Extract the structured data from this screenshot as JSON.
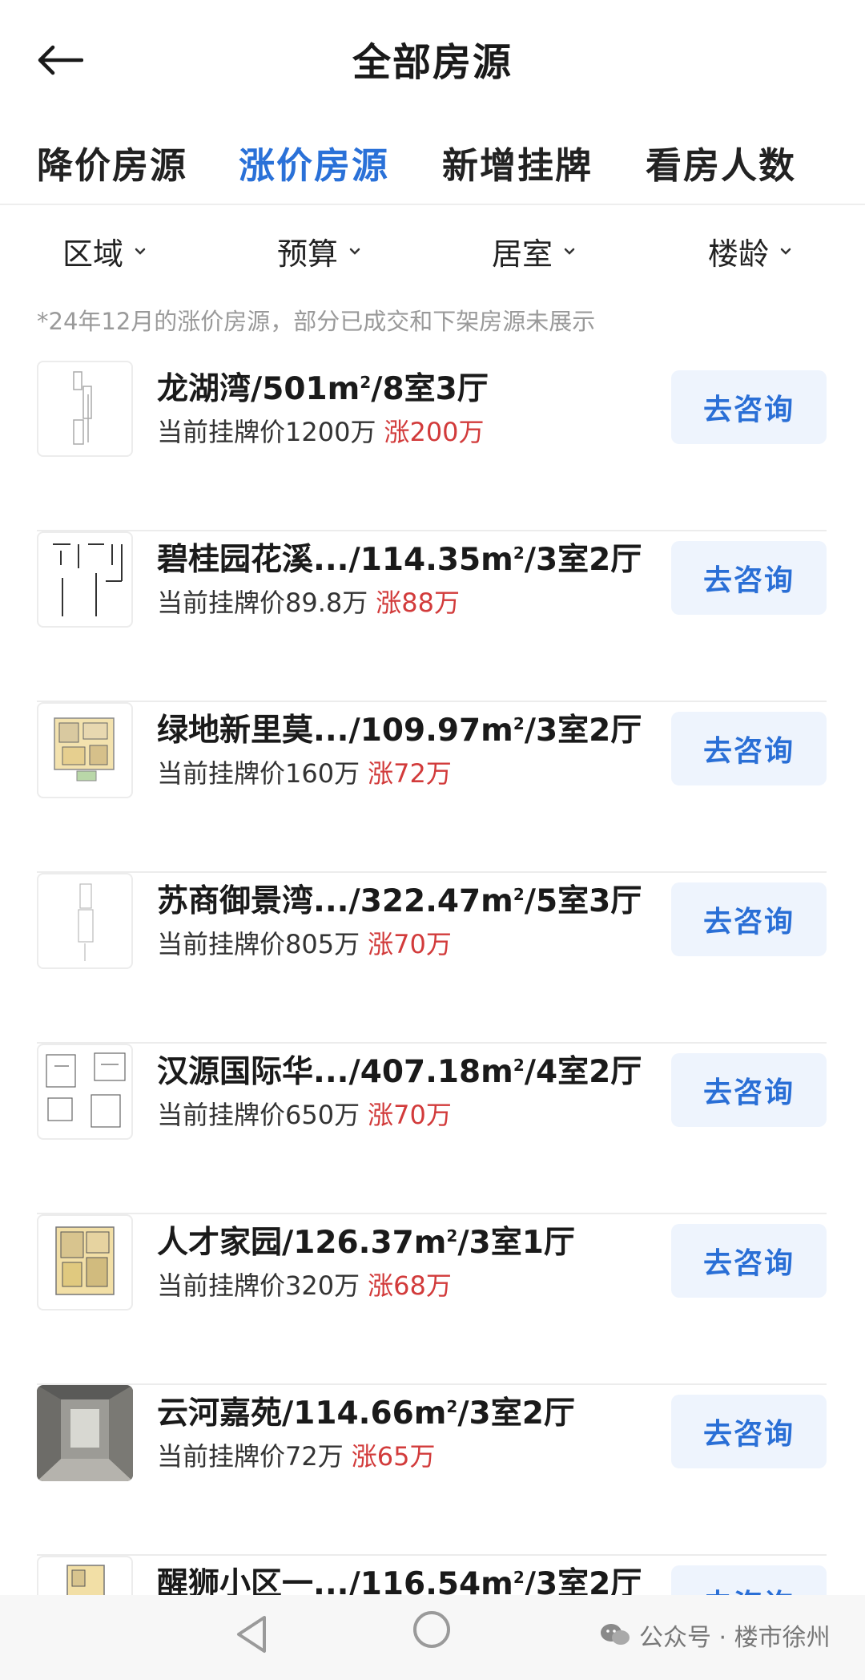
{
  "header": {
    "title": "全部房源"
  },
  "tabs": [
    {
      "label": "降价房源"
    },
    {
      "label": "涨价房源"
    },
    {
      "label": "新增挂牌"
    },
    {
      "label": "看房人数"
    }
  ],
  "filters": [
    {
      "label": "区域"
    },
    {
      "label": "预算"
    },
    {
      "label": "居室"
    },
    {
      "label": "楼龄"
    }
  ],
  "note": "*24年12月的涨价房源，部分已成交和下架房源未展示",
  "listings": [
    {
      "name": "龙湖湾/501m",
      "sup": "2",
      "rooms": "/8室3厅",
      "price": "当前挂牌价1200万",
      "rise": "涨200万",
      "button": "去咨询"
    },
    {
      "name": "碧桂园花溪.../114.35m",
      "sup": "2",
      "rooms": "/3室2厅",
      "price": "当前挂牌价89.8万",
      "rise": "涨88万",
      "button": "去咨询"
    },
    {
      "name": "绿地新里莫.../109.97m",
      "sup": "2",
      "rooms": "/3室2厅",
      "price": "当前挂牌价160万",
      "rise": "涨72万",
      "button": "去咨询"
    },
    {
      "name": "苏商御景湾.../322.47m",
      "sup": "2",
      "rooms": "/5室3厅",
      "price": "当前挂牌价805万",
      "rise": "涨70万",
      "button": "去咨询"
    },
    {
      "name": "汉源国际华.../407.18m",
      "sup": "2",
      "rooms": "/4室2厅",
      "price": "当前挂牌价650万",
      "rise": "涨70万",
      "button": "去咨询"
    },
    {
      "name": "人才家园/126.37m",
      "sup": "2",
      "rooms": "/3室1厅",
      "price": "当前挂牌价320万",
      "rise": "涨68万",
      "button": "去咨询"
    },
    {
      "name": "云河嘉苑/114.66m",
      "sup": "2",
      "rooms": "/3室2厅",
      "price": "当前挂牌价72万",
      "rise": "涨65万",
      "button": "去咨询"
    },
    {
      "name": "醒狮小区一.../116.54m",
      "sup": "2",
      "rooms": "/3室2厅",
      "price": "",
      "rise": "",
      "button": "去咨询"
    }
  ],
  "watermark": "公众号 · 楼市徐州",
  "colors": {
    "accent": "#2a71d8",
    "rise": "#d23b3b",
    "button_bg": "#eef4fd"
  }
}
